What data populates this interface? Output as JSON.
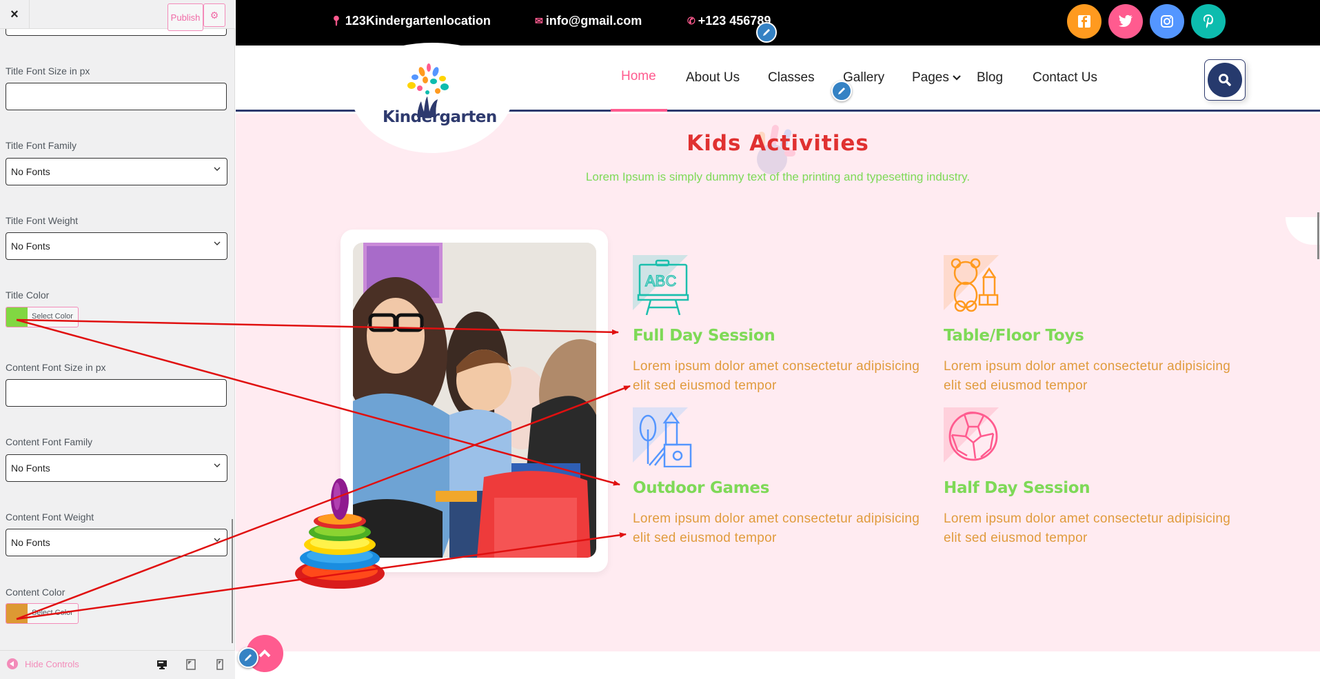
{
  "customizer": {
    "close_icon": "×",
    "publish_label": "Publish",
    "gear_icon": "⚙",
    "controls": {
      "title_font_size": {
        "label": "Title Font Size in px",
        "value": ""
      },
      "title_font_family": {
        "label": "Title Font Family",
        "value": "No Fonts"
      },
      "title_font_weight": {
        "label": "Title Font Weight",
        "value": "No Fonts"
      },
      "title_color": {
        "label": "Title Color",
        "button": "Select Color",
        "color": "#81d742"
      },
      "content_font_size": {
        "label": "Content Font Size in px",
        "value": ""
      },
      "content_font_family": {
        "label": "Content Font Family",
        "value": "No Fonts"
      },
      "content_font_weight": {
        "label": "Content Font Weight",
        "value": "No Fonts"
      },
      "content_color": {
        "label": "Content Color",
        "button": "Select Color",
        "color": "#dd9933"
      }
    },
    "footer": {
      "hide_controls": "Hide Controls"
    }
  },
  "site": {
    "topbar": {
      "location": "123Kindergartenlocation",
      "email": "info@gmail.com",
      "phone": "+123 456789",
      "social": [
        {
          "name": "facebook",
          "glyph": "f",
          "color": "#ff9a1f"
        },
        {
          "name": "twitter",
          "glyph": "t",
          "color": "#ff5b8f"
        },
        {
          "name": "instagram",
          "glyph": "◎",
          "color": "#5496ff"
        },
        {
          "name": "pinterest",
          "glyph": "p",
          "color": "#0dbcae"
        }
      ]
    },
    "logo": {
      "text": "Kindergarten"
    },
    "nav": [
      {
        "label": "Home",
        "active": true
      },
      {
        "label": "About Us"
      },
      {
        "label": "Classes"
      },
      {
        "label": "Gallery"
      },
      {
        "label": "Pages",
        "dropdown": true
      },
      {
        "label": "Blog"
      },
      {
        "label": "Contact Us"
      }
    ],
    "section": {
      "title": "Kids Activities",
      "subtitle": "Lorem Ipsum is simply dummy text of the printing and typesetting industry.",
      "title_color": "#e03131",
      "subtitle_color": "#7ed957"
    },
    "features": [
      {
        "icon": "chalkboard-abc",
        "title": "Full Day Session",
        "text": "Lorem ipsum dolor amet consectetur adipisicing elit sed eiusmod tempor",
        "icon_color": "#1bbfad",
        "tri_color": "#cfe3e6"
      },
      {
        "icon": "teddy-bear",
        "title": "Table/Floor Toys",
        "text": "Lorem ipsum dolor amet consectetur adipisicing elit sed eiusmod tempor",
        "icon_color": "#ff9a1f",
        "tri_color": "#fedacd"
      },
      {
        "icon": "playground",
        "title": "Outdoor Games",
        "text": "Lorem ipsum dolor amet consectetur adipisicing elit sed eiusmod tempor",
        "icon_color": "#5496ff",
        "tri_color": "#dde0f5"
      },
      {
        "icon": "soccer-ball",
        "title": "Half Day Session",
        "text": "Lorem ipsum dolor amet consectetur adipisicing elit sed eiusmod tempor",
        "icon_color": "#ff5b8f",
        "tri_color": "#ffd0dc"
      }
    ]
  }
}
